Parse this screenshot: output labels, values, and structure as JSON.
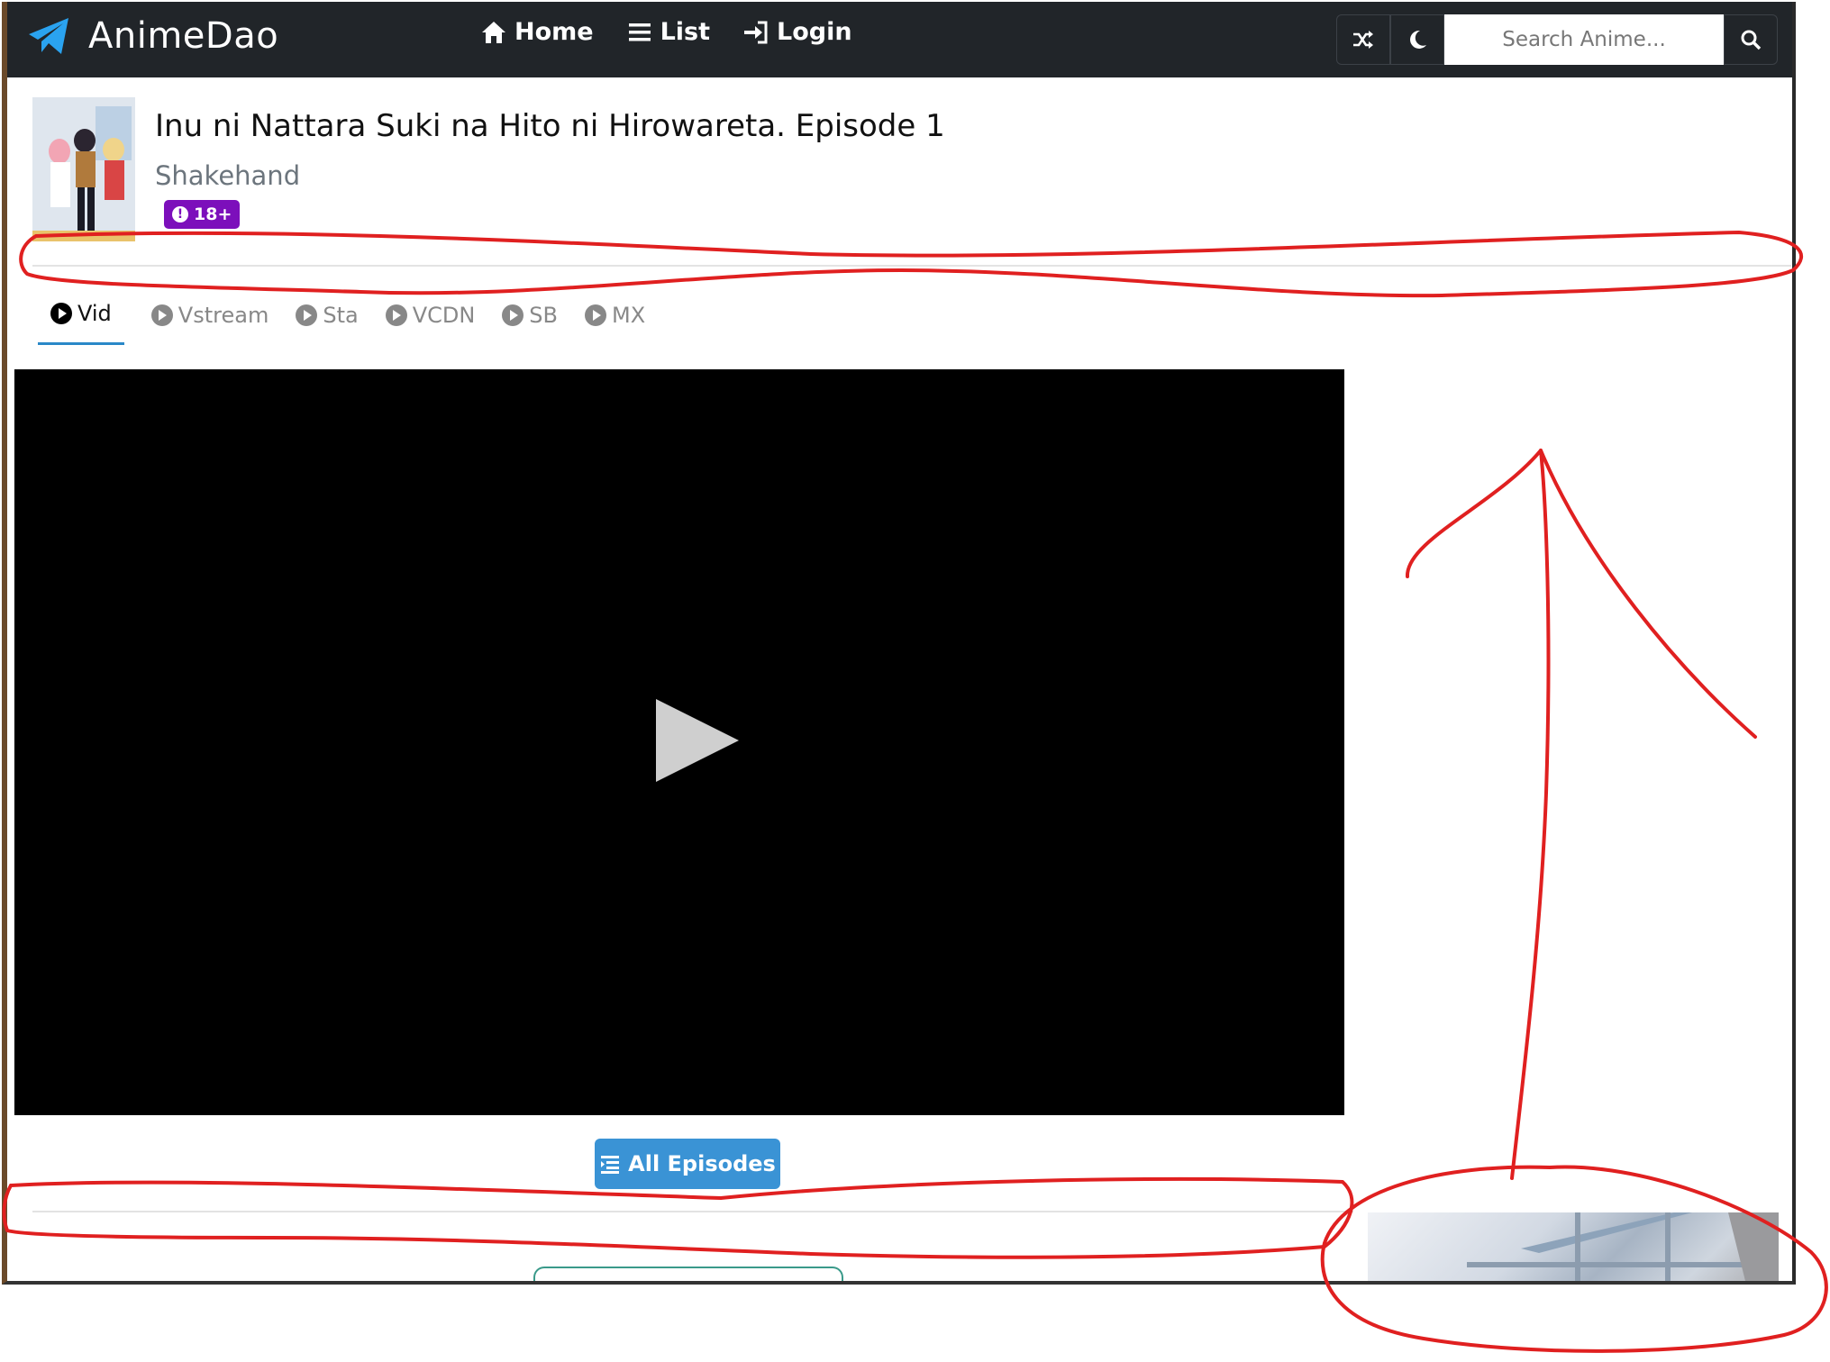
{
  "app": {
    "brand": "AnimeDao"
  },
  "nav": {
    "items": [
      {
        "label": "Home",
        "icon": "home-icon"
      },
      {
        "label": "List",
        "icon": "list-icon"
      },
      {
        "label": "Login",
        "icon": "login-icon"
      }
    ],
    "tools": [
      {
        "icon": "shuffle-icon"
      },
      {
        "icon": "moon-icon"
      }
    ],
    "search_placeholder": "Search Anime...",
    "search_icon": "search-icon"
  },
  "episode": {
    "title": "Inu ni Nattara Suki na Hito ni Hirowareta. Episode 1",
    "studio": "Shakehand",
    "age_rating": "18+"
  },
  "servers": {
    "active": "Vid",
    "tabs": [
      "Vid",
      "Vstream",
      "Sta",
      "VCDN",
      "SB",
      "MX"
    ]
  },
  "buttons": {
    "all_episodes": "All Episodes"
  },
  "colors": {
    "navbar": "#212529",
    "accent": "#3a93d5",
    "badge": "#7c0fbb",
    "annotation": "#e02020"
  }
}
